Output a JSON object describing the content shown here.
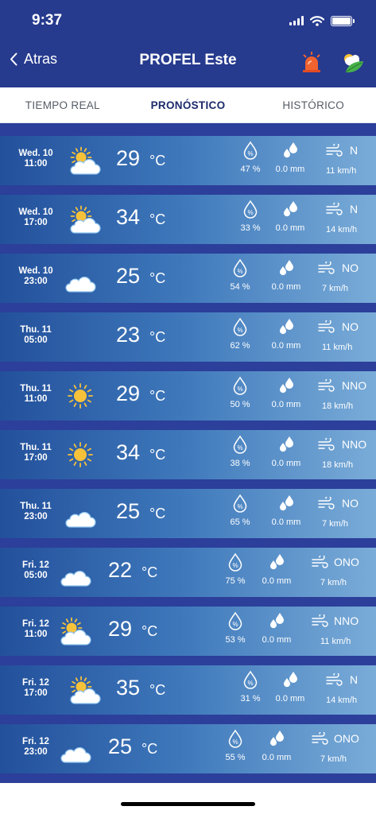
{
  "status_bar": {
    "time": "9:37"
  },
  "header": {
    "back_label": "Atras",
    "title": "PROFEL Este"
  },
  "tabs": [
    {
      "label": "TIEMPO REAL",
      "active": false
    },
    {
      "label": "PRONÓSTICO",
      "active": true
    },
    {
      "label": "HISTÓRICO",
      "active": false
    }
  ],
  "forecast": [
    {
      "day": "Wed. 10",
      "hour": "11:00",
      "icon": "partly-cloudy-day-icon",
      "temp": "29",
      "unit": "°C",
      "humidity": "47 %",
      "precip": "0.0 mm",
      "wind_dir": "N",
      "wind_speed": "11 km/h"
    },
    {
      "day": "Wed. 10",
      "hour": "17:00",
      "icon": "partly-cloudy-day-icon",
      "temp": "34",
      "unit": "°C",
      "humidity": "33 %",
      "precip": "0.0 mm",
      "wind_dir": "N",
      "wind_speed": "14 km/h"
    },
    {
      "day": "Wed. 10",
      "hour": "23:00",
      "icon": "partly-cloudy-night-icon",
      "temp": "25",
      "unit": "°C",
      "humidity": "54 %",
      "precip": "0.0 mm",
      "wind_dir": "NO",
      "wind_speed": "7 km/h"
    },
    {
      "day": "Thu. 11",
      "hour": "05:00",
      "icon": "moon-icon",
      "temp": "23",
      "unit": "°C",
      "humidity": "62 %",
      "precip": "0.0 mm",
      "wind_dir": "NO",
      "wind_speed": "11 km/h"
    },
    {
      "day": "Thu. 11",
      "hour": "11:00",
      "icon": "sun-icon",
      "temp": "29",
      "unit": "°C",
      "humidity": "50 %",
      "precip": "0.0 mm",
      "wind_dir": "NNO",
      "wind_speed": "18 km/h"
    },
    {
      "day": "Thu. 11",
      "hour": "17:00",
      "icon": "sun-icon",
      "temp": "34",
      "unit": "°C",
      "humidity": "38 %",
      "precip": "0.0 mm",
      "wind_dir": "NNO",
      "wind_speed": "18 km/h"
    },
    {
      "day": "Thu. 11",
      "hour": "23:00",
      "icon": "partly-cloudy-night-icon",
      "temp": "25",
      "unit": "°C",
      "humidity": "65 %",
      "precip": "0.0 mm",
      "wind_dir": "NO",
      "wind_speed": "7 km/h"
    },
    {
      "day": "Fri. 12",
      "hour": "05:00",
      "icon": "partly-cloudy-night-icon",
      "temp": "22",
      "unit": "°C",
      "humidity": "75 %",
      "precip": "0.0 mm",
      "wind_dir": "ONO",
      "wind_speed": "7 km/h"
    },
    {
      "day": "Fri. 12",
      "hour": "11:00",
      "icon": "partly-cloudy-day-icon",
      "temp": "29",
      "unit": "°C",
      "humidity": "53 %",
      "precip": "0.0 mm",
      "wind_dir": "NNO",
      "wind_speed": "11 km/h"
    },
    {
      "day": "Fri. 12",
      "hour": "17:00",
      "icon": "partly-cloudy-day-icon",
      "temp": "35",
      "unit": "°C",
      "humidity": "31 %",
      "precip": "0.0 mm",
      "wind_dir": "N",
      "wind_speed": "14 km/h"
    },
    {
      "day": "Fri. 12",
      "hour": "23:00",
      "icon": "partly-cloudy-night-icon",
      "temp": "25",
      "unit": "°C",
      "humidity": "55 %",
      "precip": "0.0 mm",
      "wind_dir": "ONO",
      "wind_speed": "7 km/h"
    }
  ],
  "colors": {
    "header": "#263a8e",
    "row_gradient_start": "#23509b",
    "row_gradient_end": "#7aacd8",
    "active_tab": "#1c2a6b",
    "sun": "#f7c23a",
    "moon": "#fbe28a"
  }
}
